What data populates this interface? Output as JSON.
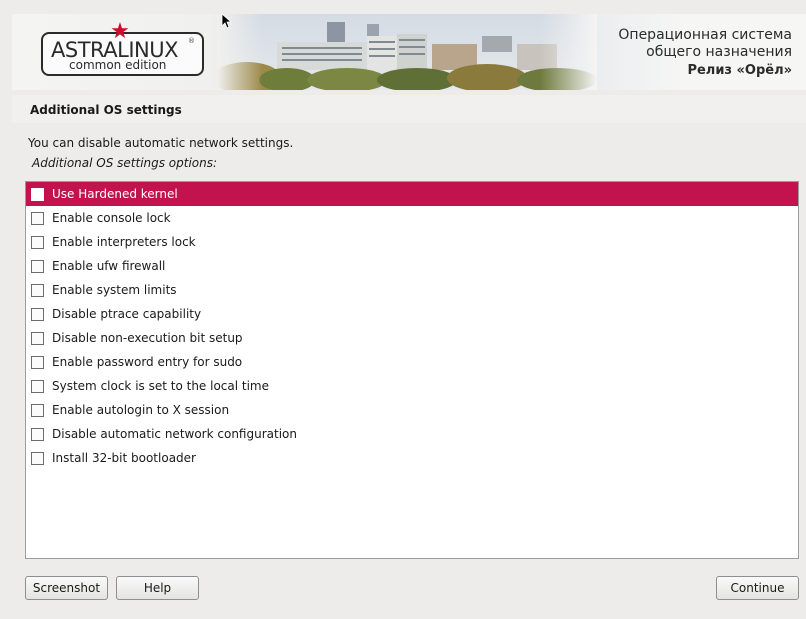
{
  "banner": {
    "logo_name": "ASTRALINUX",
    "logo_registered": "®",
    "logo_edition": "common edition",
    "star_icon": "red-star",
    "line1": "Операционная система",
    "line2": "общего назначения",
    "line3": "Релиз «Орёл»"
  },
  "page": {
    "title": "Additional OS settings",
    "description": "You can disable automatic network settings.",
    "options_label": "Additional OS settings options:"
  },
  "options": [
    {
      "label": "Use Hardened kernel",
      "checked": false,
      "selected": true
    },
    {
      "label": "Enable console lock",
      "checked": false,
      "selected": false
    },
    {
      "label": "Enable interpreters lock",
      "checked": false,
      "selected": false
    },
    {
      "label": "Enable ufw firewall",
      "checked": false,
      "selected": false
    },
    {
      "label": "Enable system limits",
      "checked": false,
      "selected": false
    },
    {
      "label": "Disable ptrace capability",
      "checked": false,
      "selected": false
    },
    {
      "label": "Disable non-execution bit setup",
      "checked": false,
      "selected": false
    },
    {
      "label": "Enable password entry for sudo",
      "checked": false,
      "selected": false
    },
    {
      "label": "System clock is set to the local time",
      "checked": false,
      "selected": false
    },
    {
      "label": "Enable autologin to X session",
      "checked": false,
      "selected": false
    },
    {
      "label": "Disable automatic network configuration",
      "checked": false,
      "selected": false
    },
    {
      "label": "Install 32-bit bootloader",
      "checked": false,
      "selected": false
    }
  ],
  "buttons": {
    "screenshot": "Screenshot",
    "help": "Help",
    "continue": "Continue"
  },
  "colors": {
    "selection": "#c3134f",
    "background": "#edeceb",
    "star": "#c8102e"
  }
}
